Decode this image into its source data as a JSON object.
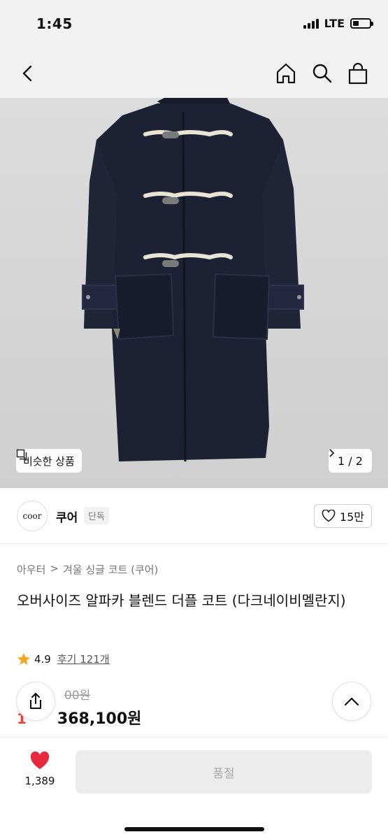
{
  "status_bar": {
    "time": "1:45",
    "network": "LTE",
    "battery_fraction": 0.35
  },
  "nav": {
    "back_icon": "chevron-left-icon",
    "home_icon": "home-icon",
    "search_icon": "search-icon",
    "bag_icon": "shopping-bag-icon"
  },
  "gallery": {
    "similar_label": "비슷한 상품",
    "page_indicator": "1 / 2",
    "current_page": 1,
    "total_pages": 2
  },
  "brand": {
    "logo_text": "coor",
    "name": "쿠어",
    "tag": "단독",
    "like_count": "15만"
  },
  "product": {
    "breadcrumb": [
      "아우터",
      "겨울 싱글 코트 (쿠어)"
    ],
    "title": "오버사이즈 알파카 블렌드 더플 코트 (다크네이비멜란지)",
    "rating": "4.9",
    "reviews_label": "후기 121개",
    "original_price": "00원",
    "discount": "1",
    "sale_price": "368,100원"
  },
  "bottom": {
    "wish_count": "1,389",
    "cta_label": "품절"
  },
  "colors": {
    "accent_red": "#f04438",
    "star": "#f5a623",
    "heart": "#e8283c"
  }
}
